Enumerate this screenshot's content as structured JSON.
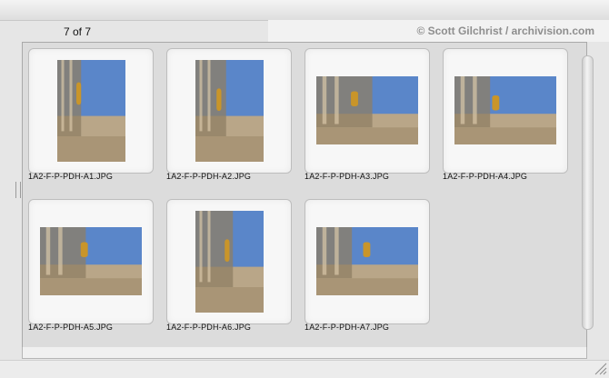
{
  "header": {
    "count_label": "7 of 7",
    "credit": "© Scott Gilchrist / archivision.com"
  },
  "thumbnails": [
    {
      "filename": "1A2-F-P-PDH-A1.JPG",
      "orientation": "portrait"
    },
    {
      "filename": "1A2-F-P-PDH-A2.JPG",
      "orientation": "portrait"
    },
    {
      "filename": "1A2-F-P-PDH-A3.JPG",
      "orientation": "landscape"
    },
    {
      "filename": "1A2-F-P-PDH-A4.JPG",
      "orientation": "landscape"
    },
    {
      "filename": "1A2-F-P-PDH-A5.JPG",
      "orientation": "landscape"
    },
    {
      "filename": "1A2-F-P-PDH-A6.JPG",
      "orientation": "portrait"
    },
    {
      "filename": "1A2-F-P-PDH-A7.JPG",
      "orientation": "landscape"
    }
  ],
  "colors": {
    "sky": "#5a86c9",
    "stone": "#b9a688",
    "stone_dark": "#8f7d63",
    "gold": "#c9952a"
  }
}
